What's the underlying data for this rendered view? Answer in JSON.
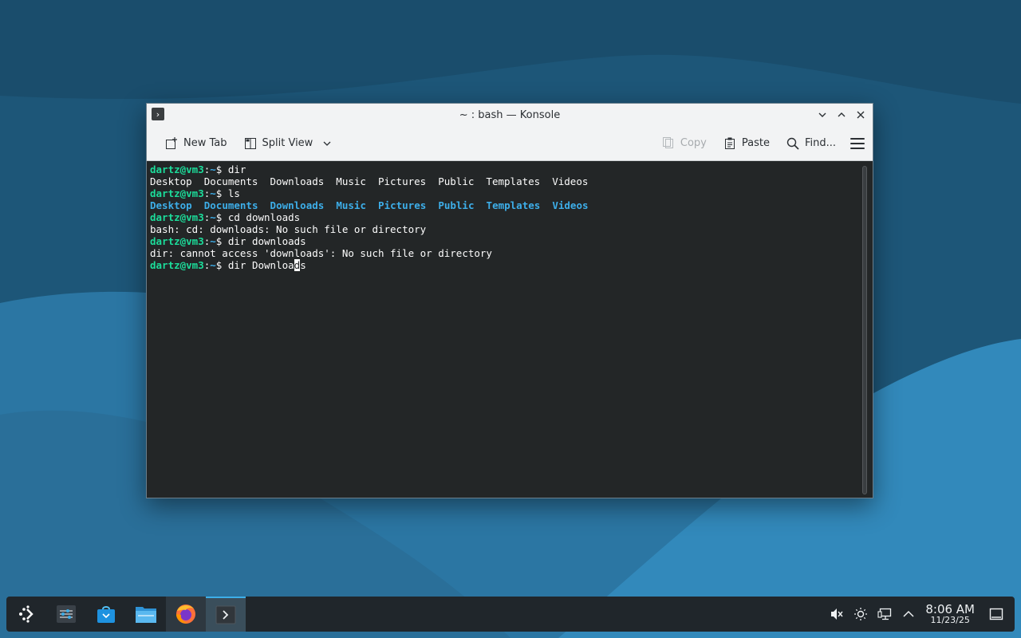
{
  "window": {
    "title": "~ : bash — Konsole",
    "buttons": [
      "minimize",
      "maximize",
      "close"
    ]
  },
  "toolbar": {
    "new_tab": "New Tab",
    "split_view": "Split View",
    "copy": "Copy",
    "paste": "Paste",
    "find": "Find..."
  },
  "terminal": {
    "prompt_user": "dartz@vm3",
    "prompt_path": "~",
    "lines": {
      "l1_cmd": "dir",
      "l2_out": "Desktop  Documents  Downloads  Music  Pictures  Public  Templates  Videos",
      "l3_cmd": "ls",
      "l4_dirs": [
        "Desktop",
        "Documents",
        "Downloads",
        "Music",
        "Pictures",
        "Public",
        "Templates",
        "Videos"
      ],
      "l5_cmd": "cd downloads",
      "l6_out": "bash: cd: downloads: No such file or directory",
      "l7_cmd": "dir downloads",
      "l8_out": "dir: cannot access 'downloads': No such file or directory",
      "l9_cmd_before": "dir Downloa",
      "l9_cursor": "d",
      "l9_cmd_after": "s"
    }
  },
  "taskbar": {
    "apps": [
      "application-launcher-icon",
      "system-settings-icon",
      "discover-store-icon",
      "file-manager-icon",
      "firefox-icon",
      "konsole-icon"
    ],
    "time": "8:06 AM",
    "date": "11/23/25"
  },
  "colors": {
    "prompt_user": "#1cdc9a",
    "prompt_path": "#3daee9",
    "terminal_bg": "#232627",
    "accent": "#3daee9"
  }
}
